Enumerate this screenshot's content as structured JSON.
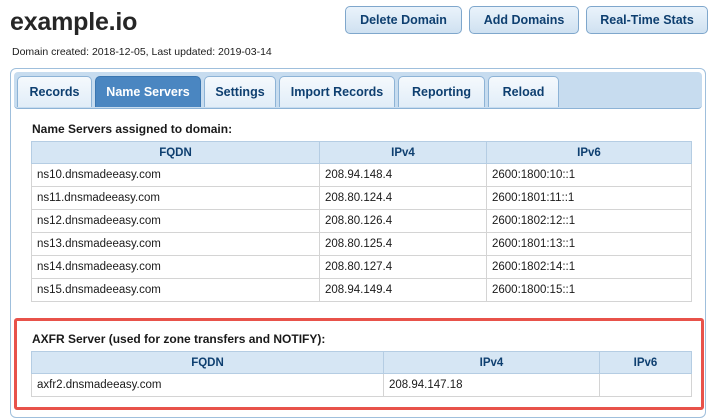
{
  "header": {
    "title": "example.io",
    "meta": "Domain created: 2018-12-05, Last updated: 2019-03-14"
  },
  "actions": {
    "delete_domain": "Delete Domain",
    "add_domains": "Add Domains",
    "realtime_stats": "Real-Time Stats"
  },
  "tabs": [
    {
      "label": "Records",
      "active": false
    },
    {
      "label": "Name Servers",
      "active": true
    },
    {
      "label": "Settings",
      "active": false
    },
    {
      "label": "Import Records",
      "active": false
    },
    {
      "label": "Reporting",
      "active": false
    },
    {
      "label": "Reload",
      "active": false
    }
  ],
  "name_servers": {
    "title": "Name Servers assigned to domain:",
    "columns": [
      "FQDN",
      "IPv4",
      "IPv6"
    ],
    "rows": [
      [
        "ns10.dnsmadeeasy.com",
        "208.94.148.4",
        "2600:1800:10::1"
      ],
      [
        "ns11.dnsmadeeasy.com",
        "208.80.124.4",
        "2600:1801:11::1"
      ],
      [
        "ns12.dnsmadeeasy.com",
        "208.80.126.4",
        "2600:1802:12::1"
      ],
      [
        "ns13.dnsmadeeasy.com",
        "208.80.125.4",
        "2600:1801:13::1"
      ],
      [
        "ns14.dnsmadeeasy.com",
        "208.80.127.4",
        "2600:1802:14::1"
      ],
      [
        "ns15.dnsmadeeasy.com",
        "208.94.149.4",
        "2600:1800:15::1"
      ]
    ]
  },
  "axfr": {
    "title": "AXFR Server (used for zone transfers and NOTIFY):",
    "columns": [
      "FQDN",
      "IPv4",
      "IPv6"
    ],
    "rows": [
      [
        "axfr2.dnsmadeeasy.com",
        "208.94.147.18",
        ""
      ]
    ]
  },
  "colors": {
    "accent": "#4a86c1",
    "highlight": "#e8524a"
  }
}
